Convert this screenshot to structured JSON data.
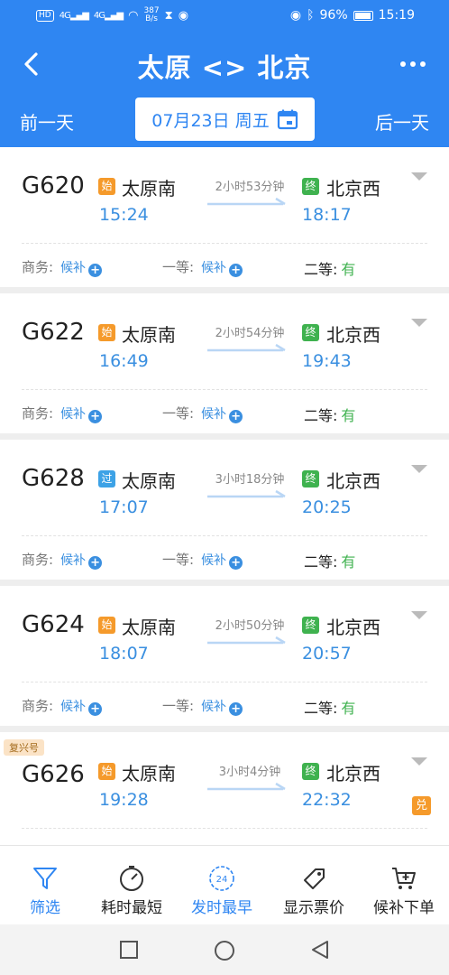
{
  "status_bar": {
    "hd": "HD",
    "net1": "4G",
    "net2": "4G",
    "speed_value": "387",
    "speed_unit": "B/s",
    "battery": "96%",
    "clock": "15:19"
  },
  "header": {
    "title": "太原 <> 北京",
    "prev_day": "前一天",
    "next_day": "后一天",
    "date": "07月23日 周五"
  },
  "trains": [
    {
      "no": "G620",
      "from_badge": "始",
      "from": "太原南",
      "dep": "15:24",
      "duration": "2小时53分钟",
      "to_badge": "终",
      "to": "北京西",
      "arr": "18:17",
      "seat_business": "商务:",
      "business_val": "候补",
      "seat_first": "一等:",
      "first_val": "候补",
      "seat_second": "二等:",
      "second_val": "有"
    },
    {
      "no": "G622",
      "from_badge": "始",
      "from": "太原南",
      "dep": "16:49",
      "duration": "2小时54分钟",
      "to_badge": "终",
      "to": "北京西",
      "arr": "19:43",
      "seat_business": "商务:",
      "business_val": "候补",
      "seat_first": "一等:",
      "first_val": "候补",
      "seat_second": "二等:",
      "second_val": "有"
    },
    {
      "no": "G628",
      "from_badge": "过",
      "from": "太原南",
      "dep": "17:07",
      "duration": "3小时18分钟",
      "to_badge": "终",
      "to": "北京西",
      "arr": "20:25",
      "seat_business": "商务:",
      "business_val": "候补",
      "seat_first": "一等:",
      "first_val": "候补",
      "seat_second": "二等:",
      "second_val": "有"
    },
    {
      "no": "G624",
      "from_badge": "始",
      "from": "太原南",
      "dep": "18:07",
      "duration": "2小时50分钟",
      "to_badge": "终",
      "to": "北京西",
      "arr": "20:57",
      "seat_business": "商务:",
      "business_val": "候补",
      "seat_first": "一等:",
      "first_val": "候补",
      "seat_second": "二等:",
      "second_val": "有"
    },
    {
      "no": "G626",
      "tag": "复兴号",
      "from_badge": "始",
      "from": "太原南",
      "dep": "19:28",
      "duration": "3小时4分钟",
      "to_badge": "终",
      "to": "北京西",
      "arr": "22:32",
      "exchange_badge": "兑"
    }
  ],
  "tabs": [
    {
      "label": "筛选",
      "icon": "filter-icon"
    },
    {
      "label": "耗时最短",
      "icon": "timer-icon"
    },
    {
      "label": "发时最早",
      "icon": "clock-24-icon"
    },
    {
      "label": "显示票价",
      "icon": "price-tag-icon"
    },
    {
      "label": "候补下单",
      "icon": "cart-plus-icon"
    }
  ],
  "colors": {
    "primary": "#2f86f2",
    "start_badge": "#f59a2b",
    "end_badge": "#3fb24f",
    "pass_badge": "#3da2e6",
    "available": "#3fb24f"
  }
}
